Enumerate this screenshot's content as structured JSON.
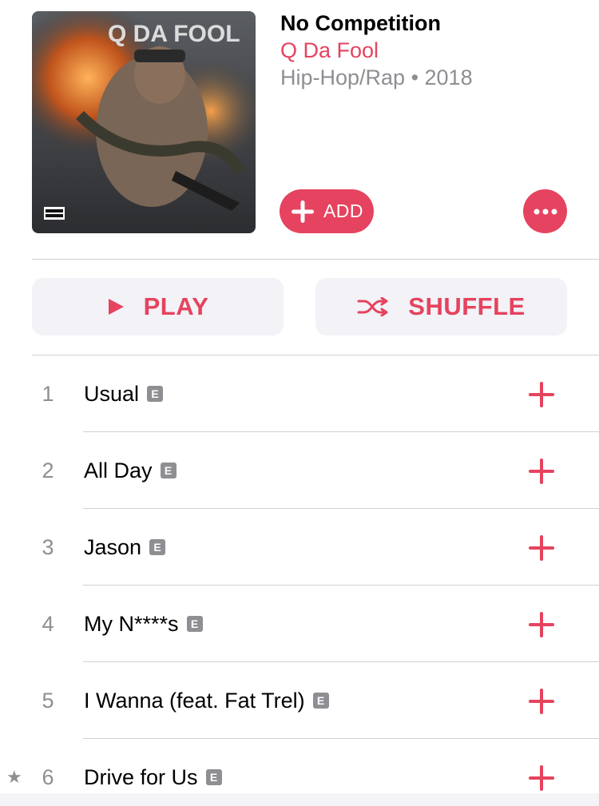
{
  "album": {
    "title": "No Competition",
    "artist": "Q Da Fool",
    "meta": "Hip-Hop/Rap • 2018",
    "art_text": "Q DA FOOL",
    "art_badge": "PARENTAL ADVISORY EXPLICIT CONTENT"
  },
  "actions": {
    "add_label": "ADD",
    "play_label": "PLAY",
    "shuffle_label": "SHUFFLE"
  },
  "tracks": [
    {
      "number": "1",
      "title": "Usual",
      "explicit": "E",
      "starred": ""
    },
    {
      "number": "2",
      "title": "All Day",
      "explicit": "E",
      "starred": ""
    },
    {
      "number": "3",
      "title": "Jason",
      "explicit": "E",
      "starred": ""
    },
    {
      "number": "4",
      "title": "My N****s",
      "explicit": "E",
      "starred": ""
    },
    {
      "number": "5",
      "title": "I Wanna (feat. Fat Trel)",
      "explicit": "E",
      "starred": ""
    },
    {
      "number": "6",
      "title": "Drive for Us",
      "explicit": "E",
      "starred": "★"
    }
  ],
  "colors": {
    "accent": "#e5435f",
    "secondary_text": "#8e8e93",
    "button_bg": "#f2f2f7"
  },
  "icons": {
    "add": "plus-icon",
    "more": "ellipsis-icon",
    "play": "play-icon",
    "shuffle": "shuffle-icon",
    "track_add": "plus-icon",
    "star": "star-icon"
  }
}
